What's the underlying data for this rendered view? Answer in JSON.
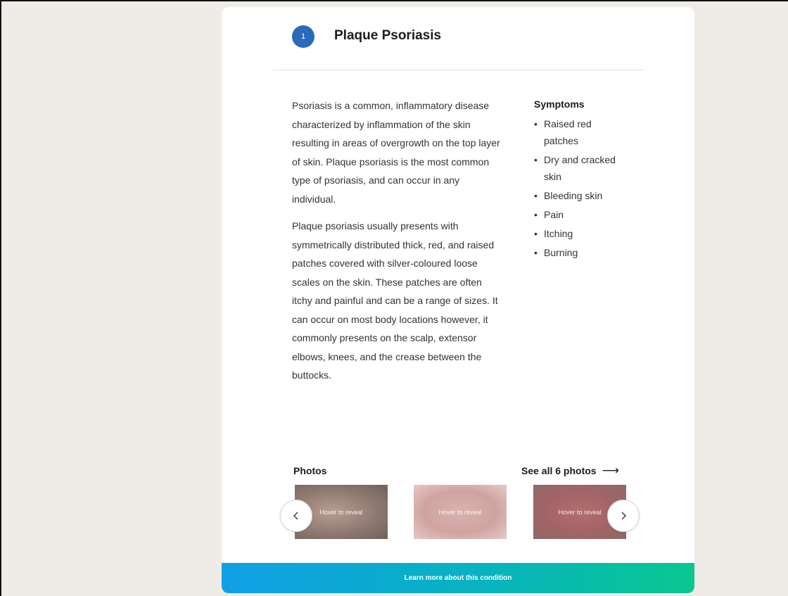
{
  "condition": {
    "step": "1",
    "title": "Plaque Psoriasis",
    "description": [
      "Psoriasis is a common, inflammatory disease characterized by inflammation of the skin resulting in areas of overgrowth on the top layer of skin. Plaque psoriasis is the most common type of psoriasis, and can occur in any individual.",
      "Plaque psoriasis usually presents with symmetrically distributed thick, red, and raised patches covered with silver-coloured loose scales on the skin. These patches are often itchy and painful and can be a range of sizes. It can occur on most body locations however, it commonly presents on the scalp, extensor elbows, knees, and the crease between the buttocks."
    ]
  },
  "symptoms": {
    "heading": "Symptoms",
    "items": [
      "Raised red patches",
      "Dry and cracked skin",
      "Bleeding skin",
      "Pain",
      "Itching",
      "Burning"
    ]
  },
  "photos": {
    "label": "Photos",
    "see_all": "See all 6 photos",
    "see_all_icon": "arrow-right-icon",
    "items": [
      {
        "overlay": "Hover to reveal"
      },
      {
        "overlay": "Hover to reveal"
      },
      {
        "overlay": "Hover to reveal"
      }
    ],
    "prev_icon": "chevron-left-icon",
    "next_icon": "chevron-right-icon"
  },
  "cta": {
    "label": "Learn more about this condition"
  },
  "colors": {
    "badge": "#2a6abc",
    "background": "#efebe6",
    "cta_gradient_start": "#11a0e6",
    "cta_gradient_end": "#0ac78f"
  }
}
